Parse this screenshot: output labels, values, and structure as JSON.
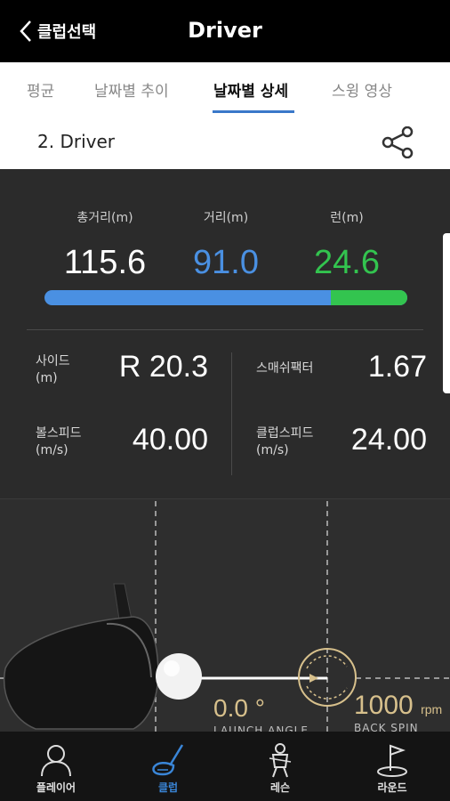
{
  "header": {
    "back_label": "클럽선택",
    "title": "Driver"
  },
  "tabs": [
    {
      "label": "평균",
      "active": false
    },
    {
      "label": "날짜별 추이",
      "active": false
    },
    {
      "label": "날짜별 상세",
      "active": true
    },
    {
      "label": "스윙 영상",
      "active": false
    }
  ],
  "club": {
    "name": "2. Driver",
    "share_icon": "share-icon"
  },
  "distance": {
    "total_label": "총거리(m)",
    "total_value": "115.6",
    "carry_label": "거리(m)",
    "carry_value": "91.0",
    "run_label": "런(m)",
    "run_value": "24.6",
    "run_fraction": 0.21,
    "carry_color": "#4a90e2",
    "run_color": "#33c44f"
  },
  "metrics": {
    "side_label_1": "사이드",
    "side_label_2": "(m)",
    "side_value": "R 20.3",
    "smash_label": "스매쉬팩터",
    "smash_value": "1.67",
    "ball_speed_label_1": "볼스피드",
    "ball_speed_label_2": "(m/s)",
    "ball_speed_value": "40.00",
    "club_speed_label_1": "클럽스피드",
    "club_speed_label_2": "(m/s)",
    "club_speed_value": "24.00"
  },
  "impact": {
    "launch_angle_value": "0.0 °",
    "launch_angle_caption": "LAUNCH ANGLE",
    "back_spin_value": "1000",
    "back_spin_unit": "rpm",
    "back_spin_caption": "BACK SPIN",
    "accent_color": "#d7c08c"
  },
  "nav": [
    {
      "label": "플레이어",
      "icon": "player-icon",
      "active": false
    },
    {
      "label": "클럽",
      "icon": "club-icon",
      "active": true
    },
    {
      "label": "레슨",
      "icon": "lesson-icon",
      "active": false
    },
    {
      "label": "라운드",
      "icon": "round-icon",
      "active": false
    }
  ]
}
